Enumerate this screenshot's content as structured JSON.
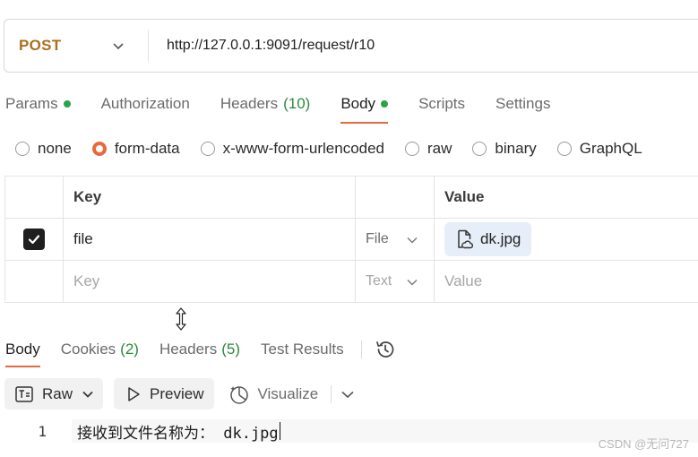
{
  "request": {
    "method": "POST",
    "url": "http://127.0.0.1:9091/request/r10"
  },
  "request_tabs": [
    {
      "label": "Params",
      "count": "",
      "dot": true
    },
    {
      "label": "Authorization",
      "count": "",
      "dot": false
    },
    {
      "label": "Headers",
      "count": "(10)",
      "dot": false
    },
    {
      "label": "Body",
      "count": "",
      "dot": true,
      "active": true
    },
    {
      "label": "Scripts",
      "count": "",
      "dot": false
    },
    {
      "label": "Settings",
      "count": "",
      "dot": false
    }
  ],
  "body_types": [
    "none",
    "form-data",
    "x-www-form-urlencoded",
    "raw",
    "binary",
    "GraphQL"
  ],
  "body_type_selected": "form-data",
  "form_table": {
    "headers": {
      "key": "Key",
      "value": "Value"
    },
    "rows": [
      {
        "checked": true,
        "key": "file",
        "type": "File",
        "value": "dk.jpg"
      }
    ],
    "empty_row": {
      "key_placeholder": "Key",
      "type": "Text",
      "value_placeholder": "Value"
    }
  },
  "response_tabs": [
    {
      "label": "Body",
      "count": "",
      "active": true
    },
    {
      "label": "Cookies",
      "count": "(2)"
    },
    {
      "label": "Headers",
      "count": "(5)"
    },
    {
      "label": "Test Results",
      "count": ""
    }
  ],
  "response_toolbar": {
    "format": "Raw",
    "preview": "Preview",
    "visualize": "Visualize"
  },
  "response_body": {
    "line_number": "1",
    "text": "接收到文件名称为： dk.jpg"
  },
  "watermark": "CSDN @无问727",
  "colors": {
    "method": "#a9701e",
    "accent": "#e8683f",
    "count_green": "#2b8a3e",
    "dot_green": "#2aa44a"
  }
}
